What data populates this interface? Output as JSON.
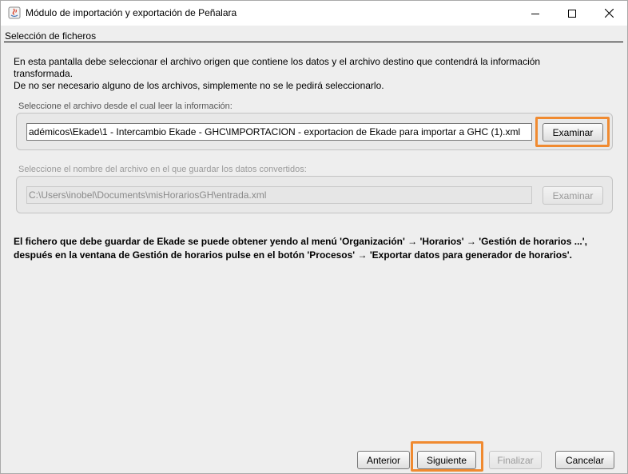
{
  "window": {
    "title": "Módulo de importación y exportación de Peñalara",
    "controls": [
      "minimize-icon",
      "maximize-icon",
      "close-icon"
    ]
  },
  "section": {
    "title": "Selección de ficheros"
  },
  "intro": {
    "line1": "En esta pantalla debe seleccionar el archivo origen que contiene los datos y el archivo destino que contendrá la información",
    "line2": "transformada.",
    "line3": "De no ser necesario alguno de los archivos, simplemente no se le pedirá seleccionarlo."
  },
  "source": {
    "label": "Seleccione el archivo desde el cual leer la información:",
    "value": "adémicos\\Ekade\\1 - Intercambio Ekade - GHC\\IMPORTACION - exportacion de Ekade para importar a GHC (1).xml",
    "button": "Examinar",
    "enabled": true
  },
  "destination": {
    "label": "Seleccione el nombre del archivo en el que guardar los datos convertidos:",
    "value": "C:\\Users\\inobel\\Documents\\misHorariosGH\\entrada.xml",
    "button": "Examinar",
    "enabled": false
  },
  "note": {
    "line1": "El fichero que debe guardar de Ekade se puede obtener yendo al menú 'Organización' → 'Horarios' → 'Gestión de horarios ...',",
    "line2": "después en la ventana de Gestión de horarios pulse en el botón 'Procesos' → 'Exportar datos para generador de horarios'."
  },
  "footer": {
    "back": "Anterior",
    "next": "Siguiente",
    "finish": "Finalizar",
    "cancel": "Cancelar"
  },
  "colors": {
    "highlight": "#f08a30",
    "window_bg": "#eeeeee"
  }
}
